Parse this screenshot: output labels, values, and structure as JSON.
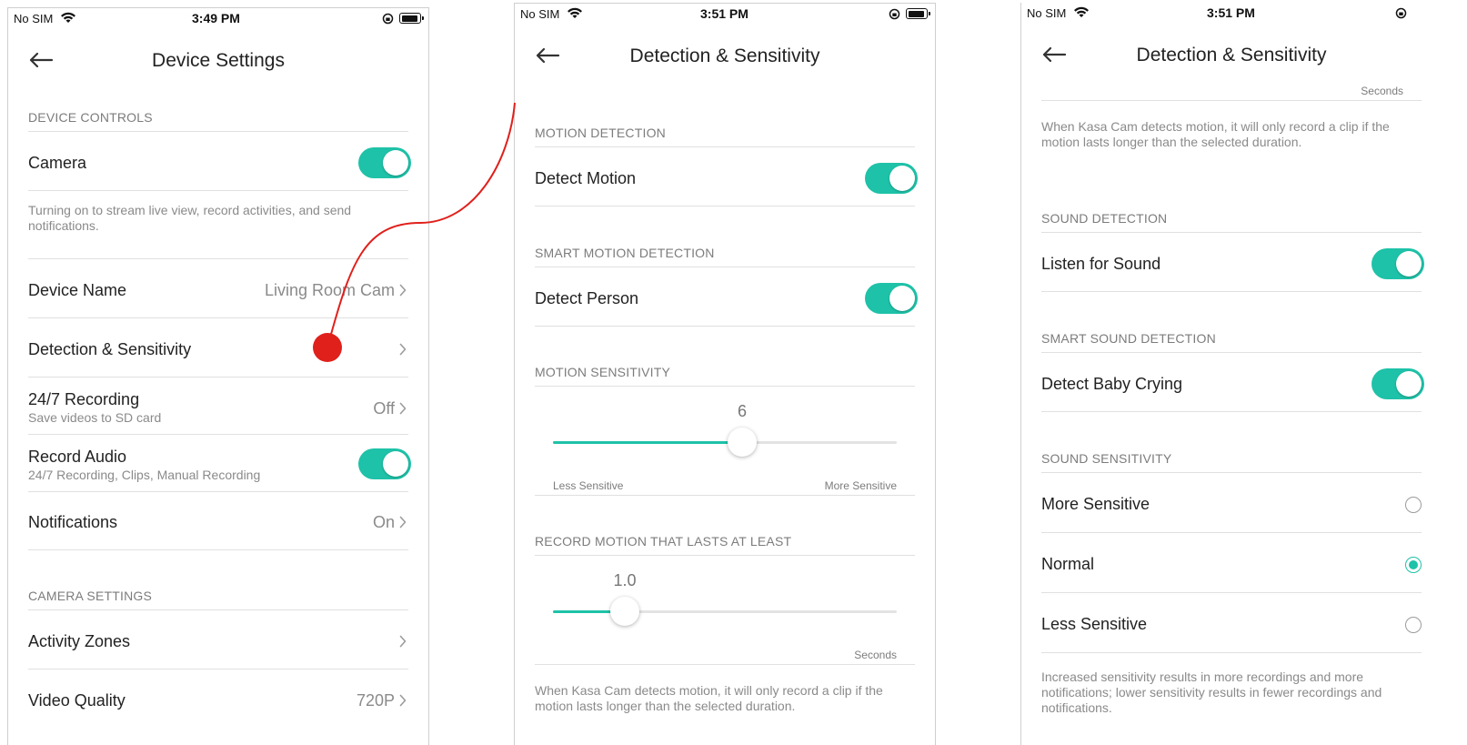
{
  "colors": {
    "accent": "#1ec2a8",
    "annotation": "#e0201b",
    "text": "#222222",
    "muted": "#8a8a8a"
  },
  "screen1": {
    "status": {
      "carrier": "No SIM",
      "time": "3:49 PM"
    },
    "title": "Device Settings",
    "section_device_controls": "DEVICE CONTROLS",
    "camera_label": "Camera",
    "camera_toggle": true,
    "camera_desc": "Turning on to stream live view, record activities, and send notifications.",
    "device_name_label": "Device Name",
    "device_name_value": "Living Room Cam",
    "detection_label": "Detection & Sensitivity",
    "recording_label": "24/7 Recording",
    "recording_sub": "Save videos to SD card",
    "recording_value": "Off",
    "record_audio_label": "Record Audio",
    "record_audio_sub": "24/7 Recording, Clips, Manual Recording",
    "record_audio_toggle": true,
    "notifications_label": "Notifications",
    "notifications_value": "On",
    "section_camera_settings": "CAMERA SETTINGS",
    "activity_zones_label": "Activity Zones",
    "video_quality_label": "Video Quality",
    "video_quality_value": "720P"
  },
  "screen2": {
    "status": {
      "carrier": "No SIM",
      "time": "3:51 PM"
    },
    "title": "Detection & Sensitivity",
    "section_motion_detection": "MOTION DETECTION",
    "detect_motion_label": "Detect Motion",
    "detect_motion_toggle": true,
    "section_smart_motion": "SMART MOTION DETECTION",
    "detect_person_label": "Detect Person",
    "detect_person_toggle": true,
    "section_motion_sensitivity": "MOTION SENSITIVITY",
    "sensitivity_value": "6",
    "sensitivity_fraction": 0.55,
    "less_sensitive": "Less Sensitive",
    "more_sensitive": "More Sensitive",
    "section_record_motion": "RECORD MOTION THAT LASTS AT LEAST",
    "duration_value": "1.0",
    "duration_fraction": 0.21,
    "duration_unit": "Seconds",
    "duration_desc": "When Kasa Cam detects motion, it will only record a clip if the motion lasts longer than the selected duration."
  },
  "screen3": {
    "status": {
      "carrier": "No SIM",
      "time": "3:51 PM"
    },
    "title": "Detection & Sensitivity",
    "seconds_label": "Seconds",
    "duration_desc": "When Kasa Cam detects motion, it will only record a clip if the motion lasts longer than the selected duration.",
    "section_sound_detection": "SOUND DETECTION",
    "listen_label": "Listen for Sound",
    "listen_toggle": true,
    "section_smart_sound": "SMART SOUND DETECTION",
    "baby_label": "Detect Baby Crying",
    "baby_toggle": true,
    "section_sound_sensitivity": "SOUND SENSITIVITY",
    "options": [
      {
        "label": "More Sensitive",
        "selected": false
      },
      {
        "label": "Normal",
        "selected": true
      },
      {
        "label": "Less Sensitive",
        "selected": false
      }
    ],
    "sensitivity_desc": "Increased sensitivity results in more recordings and more notifications; lower sensitivity results in fewer recordings and notifications."
  }
}
